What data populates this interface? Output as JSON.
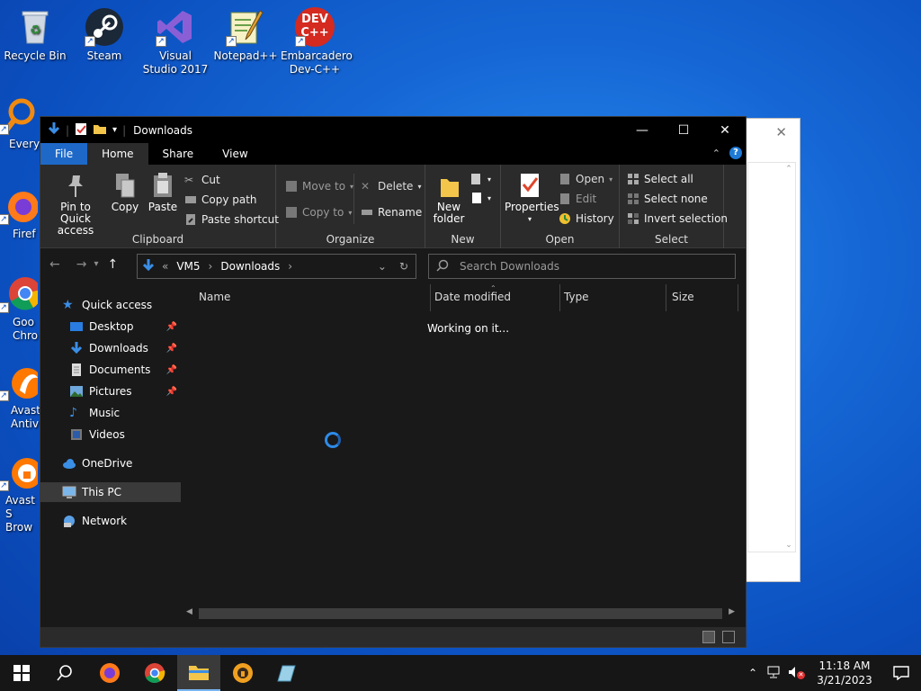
{
  "desktop": {
    "icons": [
      {
        "label": "Recycle Bin"
      },
      {
        "label": "Steam"
      },
      {
        "label": "Visual Studio 2017"
      },
      {
        "label": "Notepad++"
      },
      {
        "label": "Embarcadero Dev-C++"
      },
      {
        "label": "Everyt"
      },
      {
        "label": "Firef"
      },
      {
        "label": "Goo Chro"
      },
      {
        "label": "Avast Antiv"
      },
      {
        "label": "Avast S Brow"
      }
    ],
    "devcpp_badge": "DEV C++"
  },
  "explorer": {
    "title": "Downloads",
    "tabs": [
      "File",
      "Home",
      "Share",
      "View"
    ],
    "ribbon": {
      "clipboard": {
        "label": "Clipboard",
        "pin": "Pin to Quick access",
        "copy": "Copy",
        "paste": "Paste",
        "cut": "Cut",
        "copy_path": "Copy path",
        "paste_shortcut": "Paste shortcut"
      },
      "organize": {
        "label": "Organize",
        "move_to": "Move to",
        "copy_to": "Copy to",
        "delete": "Delete",
        "rename": "Rename"
      },
      "new": {
        "label": "New",
        "new_folder": "New folder"
      },
      "open": {
        "label": "Open",
        "properties": "Properties",
        "open": "Open",
        "edit": "Edit",
        "history": "History"
      },
      "select": {
        "label": "Select",
        "select_all": "Select all",
        "select_none": "Select none",
        "invert": "Invert selection"
      }
    },
    "address": {
      "crumbs": [
        "VM5",
        "Downloads"
      ],
      "prefix": "«",
      "search_placeholder": "Search Downloads"
    },
    "nav": {
      "quick_access": "Quick access",
      "items": [
        "Desktop",
        "Downloads",
        "Documents",
        "Pictures",
        "Music",
        "Videos"
      ],
      "onedrive": "OneDrive",
      "this_pc": "This PC",
      "network": "Network"
    },
    "columns": [
      "Name",
      "Date modified",
      "Type",
      "Size"
    ],
    "status_text": "Working on it..."
  },
  "taskbar": {
    "time": "11:18 AM",
    "date": "3/21/2023"
  },
  "colors": {
    "accent": "#1e69c8",
    "desktop": "#1668d6",
    "dark": "#191919"
  }
}
